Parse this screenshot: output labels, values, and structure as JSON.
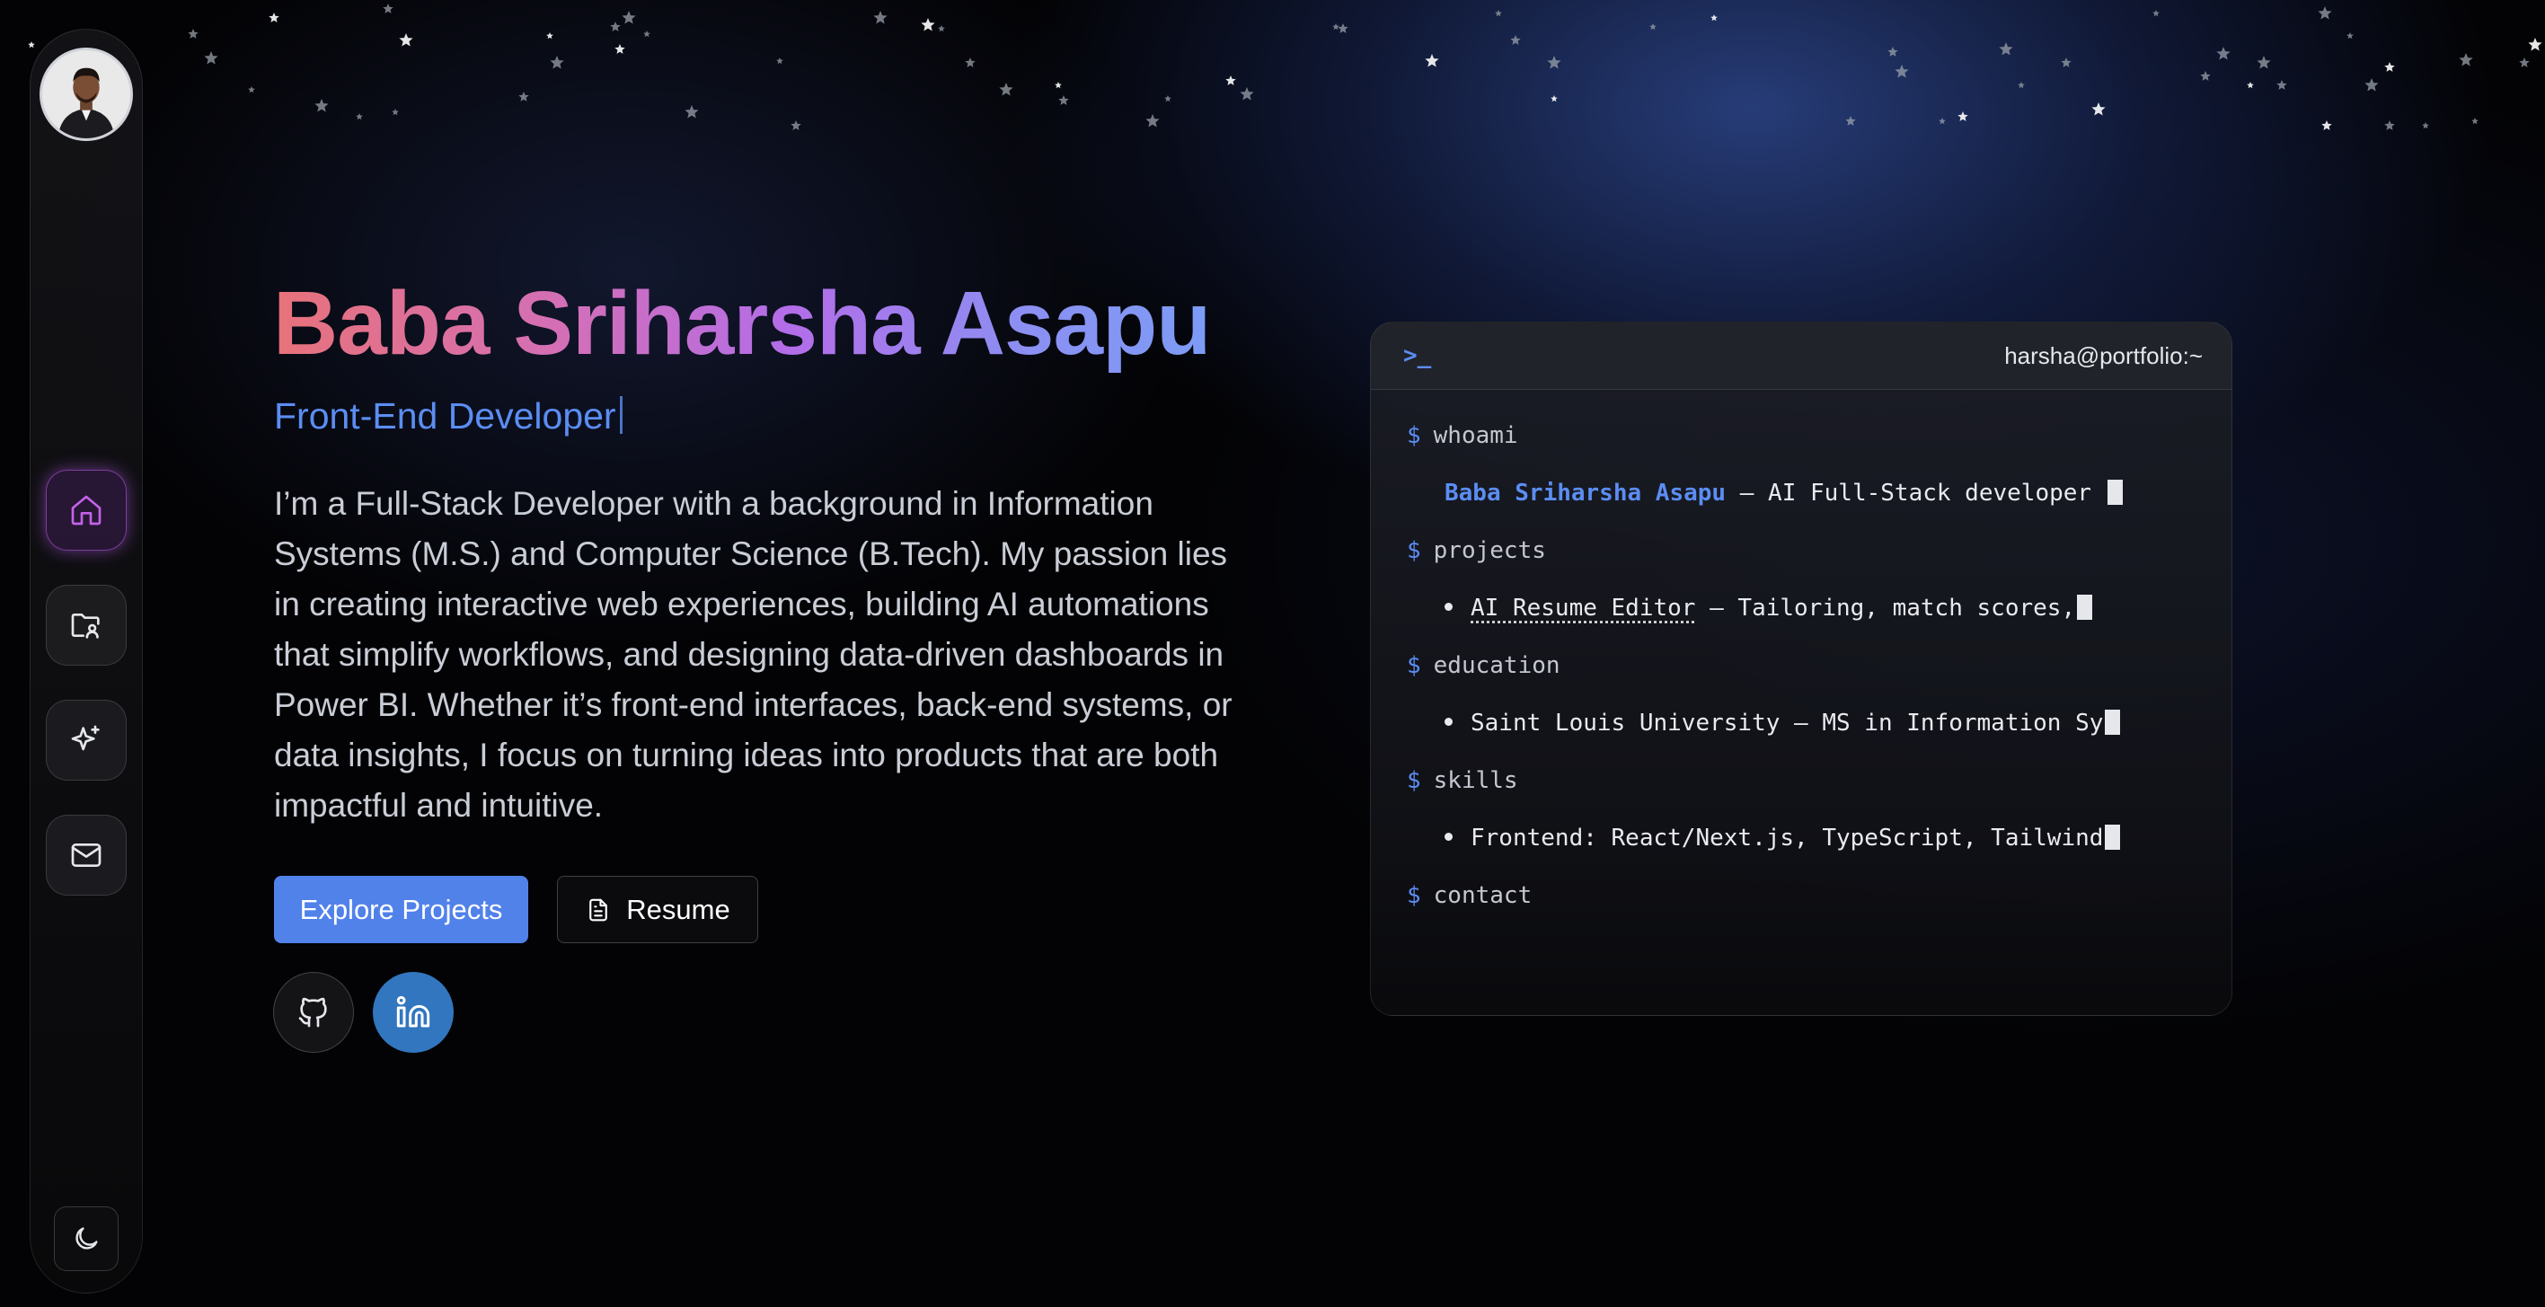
{
  "sidebar": {
    "avatar_alt": "Profile photo",
    "nav": [
      {
        "name": "home",
        "icon": "home-icon",
        "active": true
      },
      {
        "name": "projects",
        "icon": "folder-user-icon",
        "active": false
      },
      {
        "name": "skills",
        "icon": "sparkle-icon",
        "active": false
      },
      {
        "name": "contact",
        "icon": "mail-icon",
        "active": false
      }
    ],
    "theme_toggle_icon": "moon-icon"
  },
  "hero": {
    "name": "Baba Sriharsha Asapu",
    "role": "Front-End Developer",
    "bio": "I’m a Full-Stack Developer with a background in Information Systems (M.S.) and Computer Science (B.Tech). My passion lies in creating interactive web experiences, building AI automations that simplify workflows, and designing data-driven dashboards in Power BI. Whether it’s front-end interfaces, back-end systems, or data insights, I focus on turning ideas into products that are both impactful and intuitive.",
    "primary_button": "Explore Projects",
    "secondary_button": "Resume",
    "socials": [
      {
        "name": "github",
        "icon": "github-icon"
      },
      {
        "name": "linkedin",
        "icon": "linkedin-icon"
      }
    ]
  },
  "terminal": {
    "prompt_icon": ">_",
    "host": "harsha@portfolio:~",
    "prompt_symbol": "$",
    "whoami_cmd": "whoami",
    "whoami_name": "Baba Sriharsha Asapu",
    "whoami_rest": " — AI Full-Stack developer ",
    "projects_cmd": "projects",
    "project_link": "AI Resume Editor",
    "project_rest": " — Tailoring, match scores,",
    "education_cmd": "education",
    "education_line": "Saint Louis University — MS in Information Sy",
    "skills_cmd": "skills",
    "skills_line": "Frontend: React/Next.js, TypeScript, Tailwind",
    "contact_cmd": "contact"
  },
  "colors": {
    "accent": "#5b8df3",
    "primary_button": "#5182ea",
    "linkedin": "#3176bf",
    "active_nav_glow": "#b25ae6"
  }
}
